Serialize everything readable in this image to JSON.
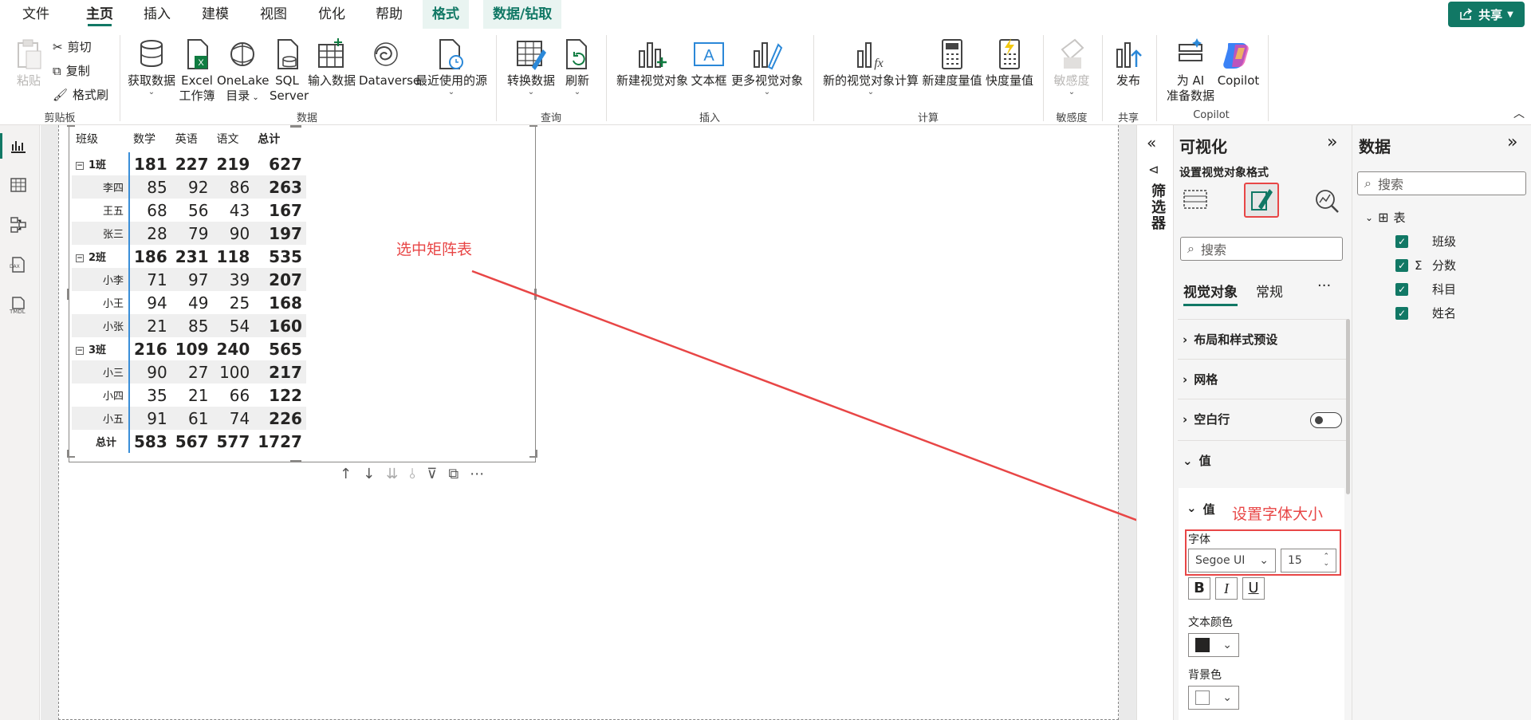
{
  "menu": {
    "tabs": [
      "文件",
      "主页",
      "插入",
      "建模",
      "视图",
      "优化",
      "帮助",
      "格式",
      "数据/钻取"
    ],
    "share": "共享"
  },
  "ribbon": {
    "clipboard": {
      "paste": "粘贴",
      "cut": "剪切",
      "copy": "复制",
      "format_painter": "格式刷",
      "group": "剪贴板"
    },
    "data": {
      "get_data": "获取数据",
      "excel_1": "Excel",
      "excel_2": "工作簿",
      "onelake_1": "OneLake",
      "onelake_2": "目录",
      "sql_1": "SQL",
      "sql_2": "Server",
      "enter_data": "输入数据",
      "dataverse": "Dataverse",
      "recent": "最近使用的源",
      "group": "数据"
    },
    "query": {
      "transform": "转换数据",
      "refresh": "刷新",
      "group": "查询"
    },
    "insert": {
      "new_visual": "新建视觉对象",
      "textbox": "文本框",
      "more_visuals": "更多视觉对象",
      "group": "插入"
    },
    "calc": {
      "new_visual_calc": "新的视觉对象计算",
      "new_measure": "新建度量值",
      "quick_measure": "快度量值",
      "group": "计算"
    },
    "sensitivity": {
      "label": "敏感度",
      "group": "敏感度"
    },
    "share": {
      "publish": "发布",
      "group": "共享"
    },
    "copilot": {
      "prep_1": "为 AI",
      "prep_2": "准备数据",
      "copilot": "Copilot",
      "group": "Copilot"
    }
  },
  "left_nav": {
    "icons": [
      "report-view-icon",
      "table-view-icon",
      "model-view-icon",
      "dax-query-icon",
      "tmdl-view-icon"
    ],
    "dax_label": "DAX",
    "tmdl_label": "TMDL"
  },
  "matrix": {
    "headers": [
      "班级",
      "数学",
      "英语",
      "语文",
      "总计"
    ],
    "groups": [
      {
        "name": "1班",
        "values": [
          "181",
          "227",
          "219",
          "627"
        ],
        "rows": [
          {
            "name": "李四",
            "values": [
              "85",
              "92",
              "86",
              "263"
            ]
          },
          {
            "name": "王五",
            "values": [
              "68",
              "56",
              "43",
              "167"
            ]
          },
          {
            "name": "张三",
            "values": [
              "28",
              "79",
              "90",
              "197"
            ]
          }
        ]
      },
      {
        "name": "2班",
        "values": [
          "186",
          "231",
          "118",
          "535"
        ],
        "rows": [
          {
            "name": "小李",
            "values": [
              "71",
              "97",
              "39",
              "207"
            ]
          },
          {
            "name": "小王",
            "values": [
              "94",
              "49",
              "25",
              "168"
            ]
          },
          {
            "name": "小张",
            "values": [
              "21",
              "85",
              "54",
              "160"
            ]
          }
        ]
      },
      {
        "name": "3班",
        "values": [
          "216",
          "109",
          "240",
          "565"
        ],
        "rows": [
          {
            "name": "小三",
            "values": [
              "90",
              "27",
              "100",
              "217"
            ]
          },
          {
            "name": "小四",
            "values": [
              "35",
              "21",
              "66",
              "122"
            ]
          },
          {
            "name": "小五",
            "values": [
              "91",
              "61",
              "74",
              "226"
            ]
          }
        ]
      }
    ],
    "total": {
      "name": "总计",
      "values": [
        "583",
        "567",
        "577",
        "1727"
      ]
    }
  },
  "annotations": {
    "select_matrix": "选中矩阵表",
    "set_font_size": "设置字体大小",
    "color": "#e84646"
  },
  "filters": {
    "label": "筛选器"
  },
  "viz_pane": {
    "title": "可视化",
    "subtitle": "设置视觉对象格式",
    "search_placeholder": "搜索",
    "tab_visual": "视觉对象",
    "tab_general": "常规",
    "more": "···",
    "sections": [
      "布局和样式预设",
      "网格",
      "空白行",
      "值"
    ],
    "card": {
      "title": "值",
      "font_label": "字体",
      "font_family": "Segoe UI",
      "font_size": "15",
      "bold": "B",
      "italic": "I",
      "underline": "U",
      "text_color_label": "文本颜色",
      "text_color": "#252423",
      "bg_color_label": "背景色",
      "bg_color": "#ffffff"
    }
  },
  "data_pane": {
    "title": "数据",
    "search_placeholder": "搜索",
    "table_name": "表",
    "fields": [
      "班级",
      "分数",
      "科目",
      "姓名"
    ]
  },
  "colors": {
    "accent": "#117865",
    "matrix_row_divider": "#3a8ed8"
  }
}
